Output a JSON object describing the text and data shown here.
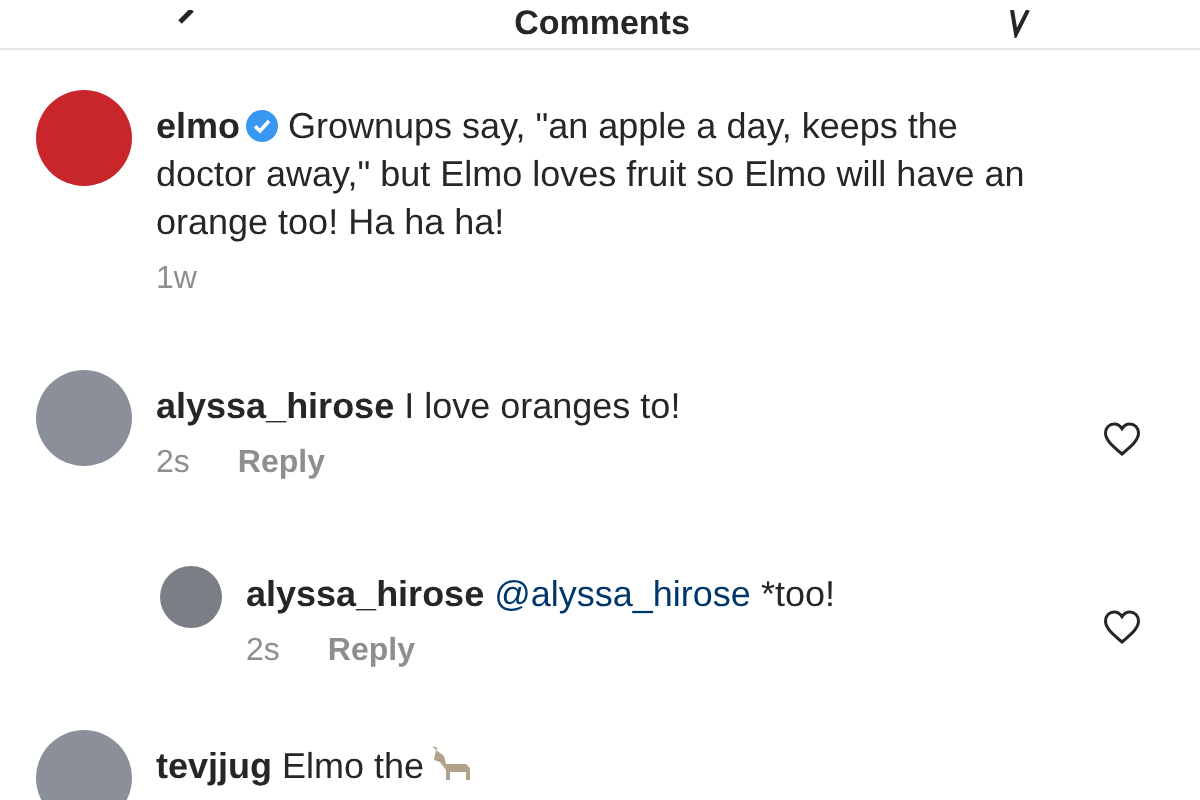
{
  "header": {
    "title": "Comments"
  },
  "caption": {
    "username": "elmo",
    "verified": true,
    "text": "Grownups say, \"an apple a day, keeps the doctor away,\" but Elmo loves fruit so Elmo will have an orange too! Ha ha ha!",
    "time": "1w"
  },
  "comments": [
    {
      "kind": "text",
      "username": "alyssa_hirose",
      "text": "I love oranges to!",
      "time": "2s",
      "reply_label": "Reply",
      "liked": false,
      "replies": [
        {
          "kind": "text",
          "username": "alyssa_hirose",
          "mention": "@alyssa_hirose",
          "text": "*too!",
          "time": "2s",
          "reply_label": "Reply",
          "liked": false
        }
      ]
    },
    {
      "kind": "text_with_icon",
      "username": "tevjjug",
      "text": "Elmo the"
    }
  ]
}
